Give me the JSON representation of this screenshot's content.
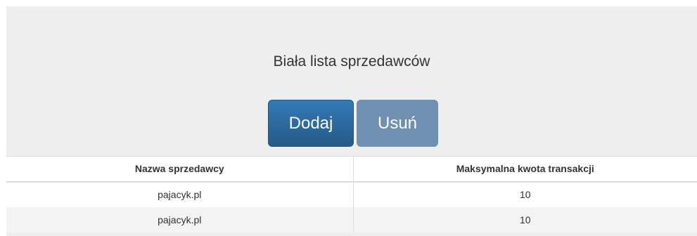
{
  "page": {
    "title": "Biała lista sprzedawców"
  },
  "toolbar": {
    "add_label": "Dodaj",
    "remove_label": "Usuń"
  },
  "table": {
    "headers": [
      "Nazwa sprzedawcy",
      "Maksymalna kwota transakcji"
    ],
    "rows": [
      [
        "pajacyk.pl",
        "10"
      ],
      [
        "pajacyk.pl",
        "10"
      ]
    ]
  },
  "colors": {
    "primary": "#337ab7",
    "primary_disabled": "#6f90b0",
    "panel_background": "#eeeeee"
  }
}
